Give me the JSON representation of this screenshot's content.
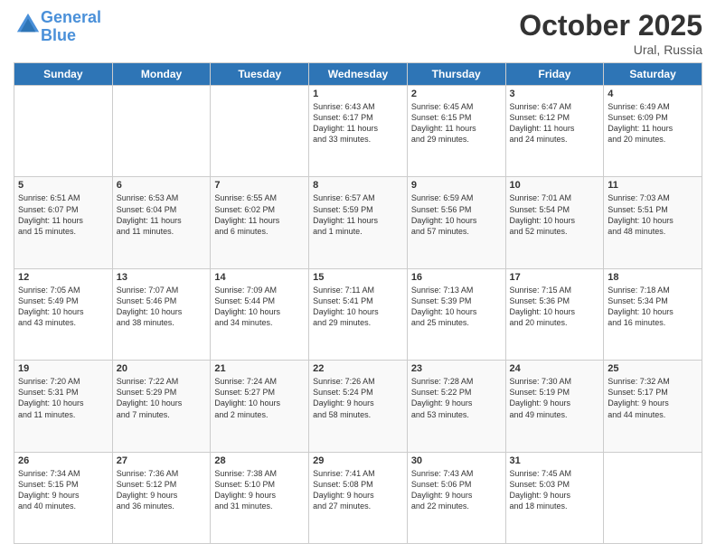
{
  "header": {
    "logo_line1": "General",
    "logo_line2": "Blue",
    "month": "October 2025",
    "location": "Ural, Russia"
  },
  "days": [
    "Sunday",
    "Monday",
    "Tuesday",
    "Wednesday",
    "Thursday",
    "Friday",
    "Saturday"
  ],
  "weeks": [
    {
      "cells": [
        {
          "date": "",
          "info": ""
        },
        {
          "date": "",
          "info": ""
        },
        {
          "date": "",
          "info": ""
        },
        {
          "date": "1",
          "info": "Sunrise: 6:43 AM\nSunset: 6:17 PM\nDaylight: 11 hours\nand 33 minutes."
        },
        {
          "date": "2",
          "info": "Sunrise: 6:45 AM\nSunset: 6:15 PM\nDaylight: 11 hours\nand 29 minutes."
        },
        {
          "date": "3",
          "info": "Sunrise: 6:47 AM\nSunset: 6:12 PM\nDaylight: 11 hours\nand 24 minutes."
        },
        {
          "date": "4",
          "info": "Sunrise: 6:49 AM\nSunset: 6:09 PM\nDaylight: 11 hours\nand 20 minutes."
        }
      ]
    },
    {
      "cells": [
        {
          "date": "5",
          "info": "Sunrise: 6:51 AM\nSunset: 6:07 PM\nDaylight: 11 hours\nand 15 minutes."
        },
        {
          "date": "6",
          "info": "Sunrise: 6:53 AM\nSunset: 6:04 PM\nDaylight: 11 hours\nand 11 minutes."
        },
        {
          "date": "7",
          "info": "Sunrise: 6:55 AM\nSunset: 6:02 PM\nDaylight: 11 hours\nand 6 minutes."
        },
        {
          "date": "8",
          "info": "Sunrise: 6:57 AM\nSunset: 5:59 PM\nDaylight: 11 hours\nand 1 minute."
        },
        {
          "date": "9",
          "info": "Sunrise: 6:59 AM\nSunset: 5:56 PM\nDaylight: 10 hours\nand 57 minutes."
        },
        {
          "date": "10",
          "info": "Sunrise: 7:01 AM\nSunset: 5:54 PM\nDaylight: 10 hours\nand 52 minutes."
        },
        {
          "date": "11",
          "info": "Sunrise: 7:03 AM\nSunset: 5:51 PM\nDaylight: 10 hours\nand 48 minutes."
        }
      ]
    },
    {
      "cells": [
        {
          "date": "12",
          "info": "Sunrise: 7:05 AM\nSunset: 5:49 PM\nDaylight: 10 hours\nand 43 minutes."
        },
        {
          "date": "13",
          "info": "Sunrise: 7:07 AM\nSunset: 5:46 PM\nDaylight: 10 hours\nand 38 minutes."
        },
        {
          "date": "14",
          "info": "Sunrise: 7:09 AM\nSunset: 5:44 PM\nDaylight: 10 hours\nand 34 minutes."
        },
        {
          "date": "15",
          "info": "Sunrise: 7:11 AM\nSunset: 5:41 PM\nDaylight: 10 hours\nand 29 minutes."
        },
        {
          "date": "16",
          "info": "Sunrise: 7:13 AM\nSunset: 5:39 PM\nDaylight: 10 hours\nand 25 minutes."
        },
        {
          "date": "17",
          "info": "Sunrise: 7:15 AM\nSunset: 5:36 PM\nDaylight: 10 hours\nand 20 minutes."
        },
        {
          "date": "18",
          "info": "Sunrise: 7:18 AM\nSunset: 5:34 PM\nDaylight: 10 hours\nand 16 minutes."
        }
      ]
    },
    {
      "cells": [
        {
          "date": "19",
          "info": "Sunrise: 7:20 AM\nSunset: 5:31 PM\nDaylight: 10 hours\nand 11 minutes."
        },
        {
          "date": "20",
          "info": "Sunrise: 7:22 AM\nSunset: 5:29 PM\nDaylight: 10 hours\nand 7 minutes."
        },
        {
          "date": "21",
          "info": "Sunrise: 7:24 AM\nSunset: 5:27 PM\nDaylight: 10 hours\nand 2 minutes."
        },
        {
          "date": "22",
          "info": "Sunrise: 7:26 AM\nSunset: 5:24 PM\nDaylight: 9 hours\nand 58 minutes."
        },
        {
          "date": "23",
          "info": "Sunrise: 7:28 AM\nSunset: 5:22 PM\nDaylight: 9 hours\nand 53 minutes."
        },
        {
          "date": "24",
          "info": "Sunrise: 7:30 AM\nSunset: 5:19 PM\nDaylight: 9 hours\nand 49 minutes."
        },
        {
          "date": "25",
          "info": "Sunrise: 7:32 AM\nSunset: 5:17 PM\nDaylight: 9 hours\nand 44 minutes."
        }
      ]
    },
    {
      "cells": [
        {
          "date": "26",
          "info": "Sunrise: 7:34 AM\nSunset: 5:15 PM\nDaylight: 9 hours\nand 40 minutes."
        },
        {
          "date": "27",
          "info": "Sunrise: 7:36 AM\nSunset: 5:12 PM\nDaylight: 9 hours\nand 36 minutes."
        },
        {
          "date": "28",
          "info": "Sunrise: 7:38 AM\nSunset: 5:10 PM\nDaylight: 9 hours\nand 31 minutes."
        },
        {
          "date": "29",
          "info": "Sunrise: 7:41 AM\nSunset: 5:08 PM\nDaylight: 9 hours\nand 27 minutes."
        },
        {
          "date": "30",
          "info": "Sunrise: 7:43 AM\nSunset: 5:06 PM\nDaylight: 9 hours\nand 22 minutes."
        },
        {
          "date": "31",
          "info": "Sunrise: 7:45 AM\nSunset: 5:03 PM\nDaylight: 9 hours\nand 18 minutes."
        },
        {
          "date": "",
          "info": ""
        }
      ]
    }
  ]
}
